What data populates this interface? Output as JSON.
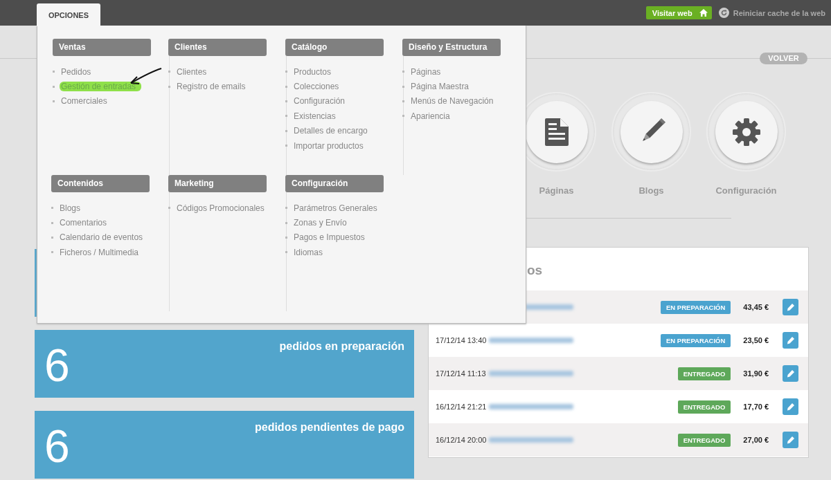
{
  "topbar": {
    "menu_tab": {
      "label": "OPCIONES",
      "selected": true
    },
    "visit_button": "Visitar web",
    "cache_link": "Reiniciar cache de la web"
  },
  "back_button": "VOLVER",
  "menu": {
    "sections": [
      {
        "title": "Ventas",
        "items": [
          {
            "label": "Pedidos",
            "highlighted": false
          },
          {
            "label": "Gestión de entradas",
            "highlighted": true
          },
          {
            "label": "Comerciales",
            "highlighted": false
          }
        ]
      },
      {
        "title": "Clientes",
        "items": [
          {
            "label": "Clientes",
            "highlighted": false
          },
          {
            "label": "Registro de emails",
            "highlighted": false
          }
        ]
      },
      {
        "title": "Catálogo",
        "items": [
          {
            "label": "Productos",
            "highlighted": false
          },
          {
            "label": "Colecciones",
            "highlighted": false
          },
          {
            "label": "Configuración",
            "highlighted": false
          },
          {
            "label": "Existencias",
            "highlighted": false
          },
          {
            "label": "Detalles de encargo",
            "highlighted": false
          },
          {
            "label": "Importar productos",
            "highlighted": false
          }
        ]
      },
      {
        "title": "Diseño y Estructura",
        "items": [
          {
            "label": "Páginas",
            "highlighted": false
          },
          {
            "label": "Página Maestra",
            "highlighted": false
          },
          {
            "label": "Menús de Navegación",
            "highlighted": false
          },
          {
            "label": "Apariencia",
            "highlighted": false
          }
        ]
      },
      {
        "title": "Contenidos",
        "items": [
          {
            "label": "Blogs",
            "highlighted": false
          },
          {
            "label": "Comentarios",
            "highlighted": false
          },
          {
            "label": "Calendario de eventos",
            "highlighted": false
          },
          {
            "label": "Ficheros / Multimedia",
            "highlighted": false
          }
        ]
      },
      {
        "title": "Marketing",
        "items": [
          {
            "label": "Códigos Promocionales",
            "highlighted": false
          }
        ]
      },
      {
        "title": "Configuración",
        "items": [
          {
            "label": "Parámetros Generales",
            "highlighted": false
          },
          {
            "label": "Zonas y Envío",
            "highlighted": false
          },
          {
            "label": "Pagos e Impuestos",
            "highlighted": false
          },
          {
            "label": "Idiomas",
            "highlighted": false
          }
        ]
      }
    ]
  },
  "shortcuts": [
    {
      "kind": "document",
      "label": "Páginas"
    },
    {
      "kind": "pencil",
      "label": "Blogs"
    },
    {
      "kind": "gear",
      "label": "Configuración"
    }
  ],
  "stats": [
    {
      "value": "6",
      "label": "pedidos en preparación"
    },
    {
      "value": "6",
      "label": "pedidos pendientes de pago"
    }
  ],
  "orders": {
    "title": "os",
    "rows": [
      {
        "date": "",
        "status": "EN PREPARACIÓN",
        "color": "#4aa3cf",
        "total": "43,45 €"
      },
      {
        "date": "17/12/14 13:40",
        "status": "EN PREPARACIÓN",
        "color": "#4aa3cf",
        "total": "23,50 €"
      },
      {
        "date": "17/12/14 11:13",
        "status": "ENTREGADO",
        "color": "#5ea85a",
        "total": "31,90 €"
      },
      {
        "date": "16/12/14 21:21",
        "status": "ENTREGADO",
        "color": "#5ea85a",
        "total": "17,70 €"
      },
      {
        "date": "16/12/14 20:00",
        "status": "ENTREGADO",
        "color": "#5ea85a",
        "total": "27,00 €"
      }
    ]
  }
}
